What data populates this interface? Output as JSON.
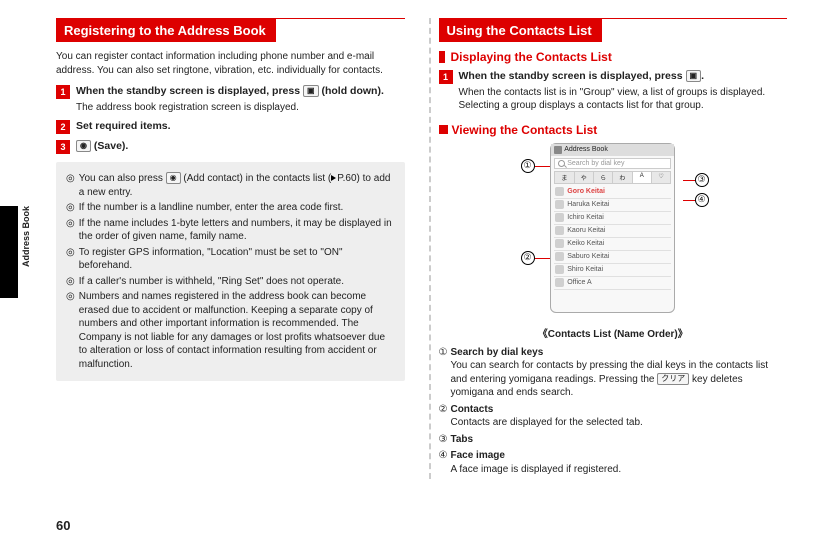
{
  "pagenum": "60",
  "side_label": "Address Book",
  "left": {
    "heading": "Registering to the Address Book",
    "intro": "You can register contact information including phone number and e-mail address. You can also set ringtone, vibration, etc. individually for contacts.",
    "step1_pre": "When the standby screen is displayed, press ",
    "step1_key": "▣",
    "step1_post": " (hold down).",
    "step1_desc": "The address book registration screen is displayed.",
    "step2": "Set required items.",
    "step3_key": "◉",
    "step3_post": " (Save).",
    "notes": {
      "n1a": "You can also press ",
      "n1key": "◉",
      "n1b": " (Add contact) in the contacts list (",
      "n1c": "P.60) to add a new entry.",
      "n2": "If the number is a landline number, enter the area code first.",
      "n3": "If the name includes 1-byte letters and numbers, it may be displayed in the order of given name, family name.",
      "n4": "To register GPS information, \"Location\" must be set to \"ON\" beforehand.",
      "n5": "If a caller's number is withheld, \"Ring Set\" does not operate.",
      "n6": "Numbers and names registered in the address book can become erased due to accident or malfunction. Keeping a separate copy of numbers and other important information is recommended. The Company is not liable for any damages or lost profits whatsoever due to alteration or loss of contact information resulting from accident or malfunction."
    }
  },
  "right": {
    "heading": "Using the Contacts List",
    "sub1": "Displaying the Contacts List",
    "step1_pre": "When the standby screen is displayed, press ",
    "step1_key": "▣",
    "step1_post": ".",
    "step1_desc": "When the contacts list is in \"Group\" view, a list of groups is displayed. Selecting a group displays a contacts list for that group.",
    "sub2": "Viewing the Contacts List",
    "phone": {
      "title": "Address Book",
      "search": "Search by dial key",
      "tabs": [
        "ま",
        "や",
        "ら",
        "わ",
        "A",
        "♡"
      ],
      "rows": [
        "Goro Keitai",
        "Haruka Keitai",
        "Ichiro Keitai",
        "Kaoru Keitai",
        "Keiko Keitai",
        "Saburo Keitai",
        "Shiro Keitai",
        "Office A"
      ]
    },
    "callouts": {
      "c1": "①",
      "c2": "②",
      "c3": "③",
      "c4": "④"
    },
    "fig_caption": "《Contacts List (Name Order)》",
    "items": {
      "i1n": "①",
      "i1t": "Search by dial keys",
      "i1d_a": "You can search for contacts by pressing the dial keys in the contacts list and entering yomigana readings. Pressing the ",
      "i1key": "クリア",
      "i1d_b": " key deletes yomigana and ends search.",
      "i2n": "②",
      "i2t": "Contacts",
      "i2d": "Contacts are displayed for the selected tab.",
      "i3n": "③",
      "i3t": "Tabs",
      "i4n": "④",
      "i4t": "Face image",
      "i4d": "A face image is displayed if registered."
    }
  }
}
